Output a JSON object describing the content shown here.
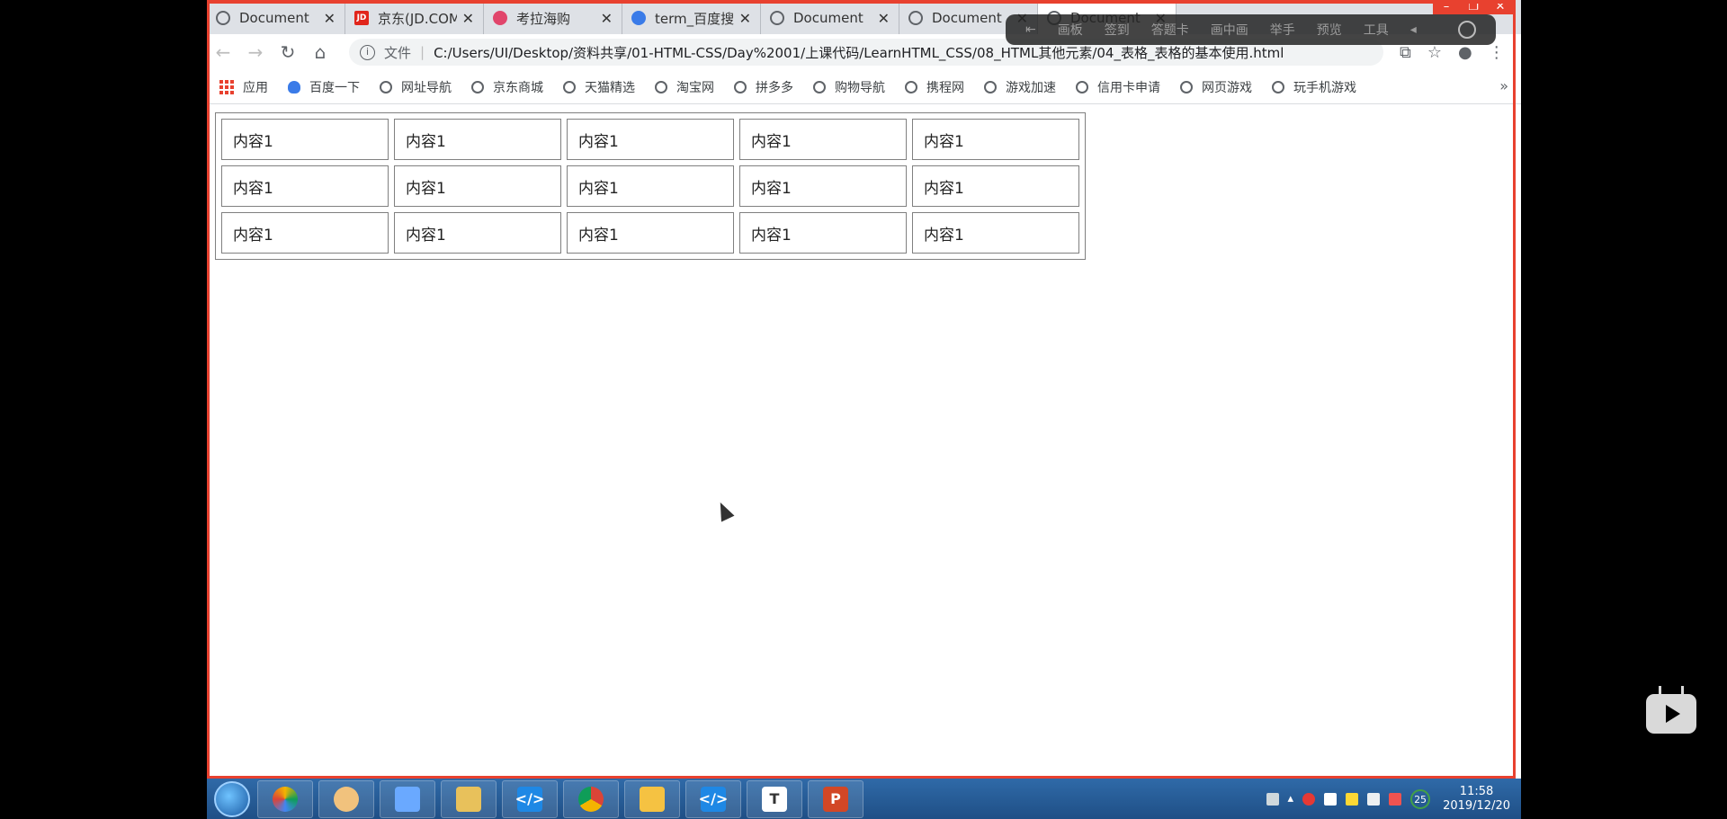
{
  "browser": {
    "tabs": [
      {
        "label": "Document",
        "favicon": "globe-icon",
        "active": false
      },
      {
        "label": "京东(JD.COM)",
        "favicon": "jd-icon",
        "active": false
      },
      {
        "label": "考拉海购",
        "favicon": "kaola-icon",
        "active": false
      },
      {
        "label": "term_百度搜索",
        "favicon": "baidu-icon",
        "active": false
      },
      {
        "label": "Document",
        "favicon": "globe-icon",
        "active": false
      },
      {
        "label": "Document",
        "favicon": "globe-icon",
        "active": false
      },
      {
        "label": "Document",
        "favicon": "globe-icon",
        "active": true
      }
    ],
    "address": {
      "file_label": "文件",
      "url": "C:/Users/UI/Desktop/资料共享/01-HTML-CSS/Day%2001/上课代码/LearnHTML_CSS/08_HTML其他元素/04_表格_表格的基本使用.html"
    },
    "bookmarks": [
      "应用",
      "百度一下",
      "网址导航",
      "京东商城",
      "天猫精选",
      "淘宝网",
      "拼多多",
      "购物导航",
      "携程网",
      "游戏加速",
      "信用卡申请",
      "网页游戏",
      "玩手机游戏"
    ],
    "more_glyph": "»"
  },
  "overlay_toolbar": {
    "items": [
      "画板",
      "签到",
      "答题卡",
      "画中画",
      "举手",
      "预览",
      "工具"
    ]
  },
  "page_table": {
    "rows": [
      [
        "内容1",
        "内容1",
        "内容1",
        "内容1",
        "内容1"
      ],
      [
        "内容1",
        "内容1",
        "内容1",
        "内容1",
        "内容1"
      ],
      [
        "内容1",
        "内容1",
        "内容1",
        "内容1",
        "内容1"
      ]
    ]
  },
  "taskbar": {
    "apps": [
      "color-swirl-app",
      "avatar-app",
      "feather-app",
      "file-manager-app",
      "vscode-app",
      "chrome-app",
      "calendar-app",
      "vscode-app",
      "typora-app",
      "powerpoint-app"
    ],
    "tray_badge": "25",
    "time": "11:58",
    "date": "2019/12/20"
  }
}
